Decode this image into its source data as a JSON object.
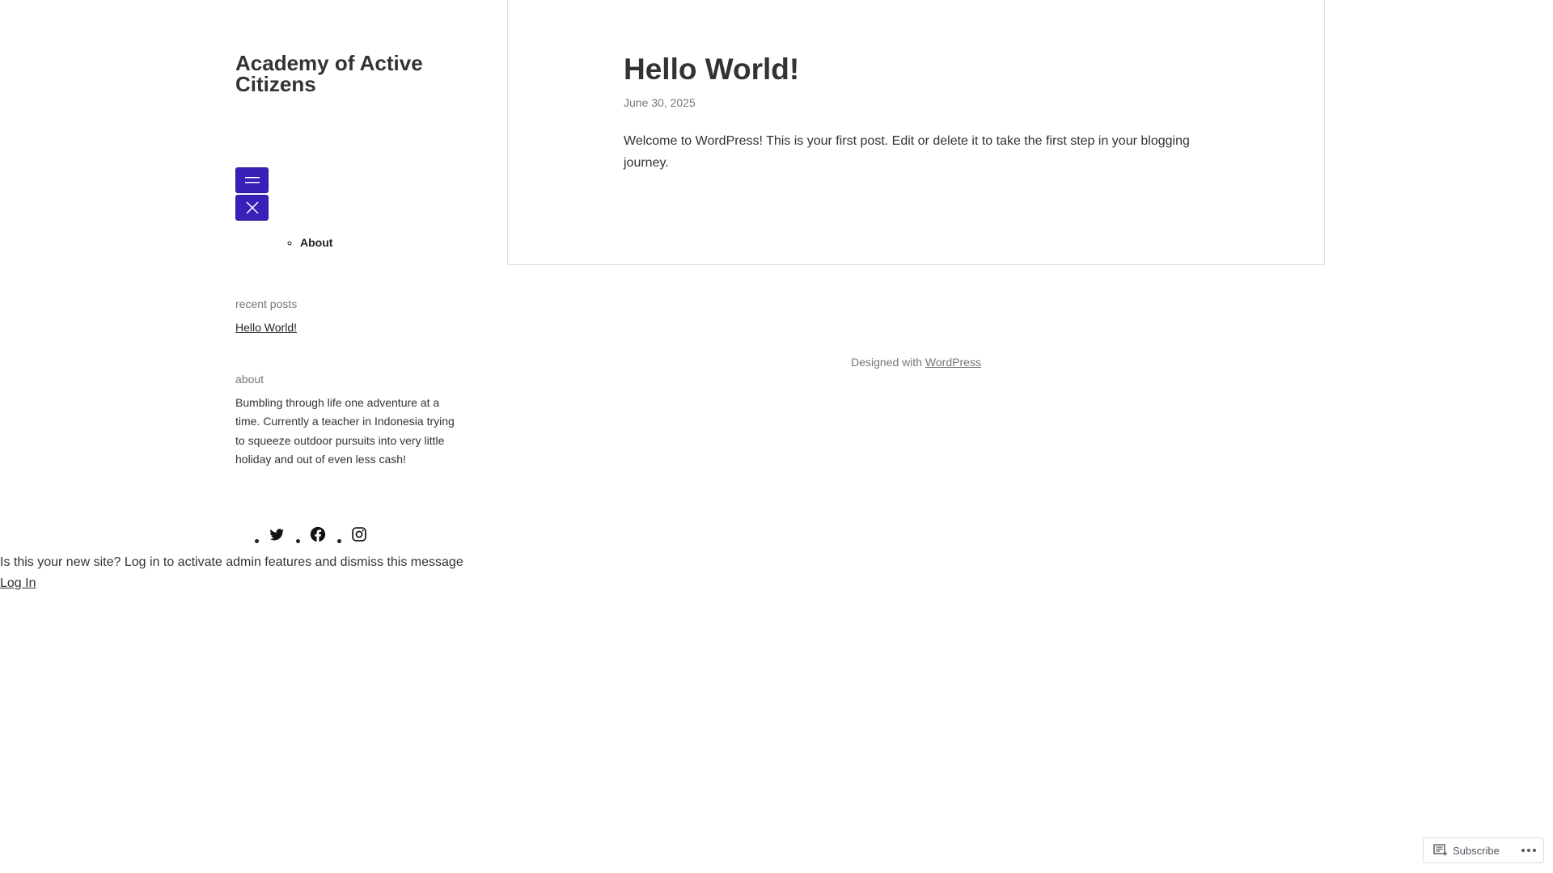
{
  "site": {
    "title": "Academy of Active Citizens"
  },
  "menu": {
    "open_icon": "hamburger-icon",
    "close_icon": "close-icon",
    "items": [
      {
        "label": "About"
      }
    ]
  },
  "widgets": {
    "recent_posts": {
      "title": "recent posts",
      "items": [
        {
          "label": "Hello World!"
        }
      ]
    },
    "about": {
      "title": "about",
      "text": "Bumbling through life one adventure at a time. Currently a teacher in Indonesia trying to squeeze outdoor pursuits into very little holiday and out of even less cash!"
    },
    "social": [
      {
        "icon": "twitter-icon"
      },
      {
        "icon": "facebook-icon"
      },
      {
        "icon": "instagram-icon"
      }
    ]
  },
  "post": {
    "title": "Hello World!",
    "date": "June 30, 2025",
    "body": "Welcome to WordPress! This is your first post. Edit or delete it to take the first step in your blogging journey."
  },
  "footer": {
    "credit_prefix": "Designed with",
    "credit_link": "WordPress"
  },
  "admin_notice": {
    "message": "Is this your new site? Log in to activate admin features and dismiss this message",
    "login_label": "Log In"
  },
  "subscribe_bar": {
    "subscribe_label": "Subscribe",
    "subscribe_icon": "reader-icon",
    "more_icon": "ellipsis-icon"
  },
  "colors": {
    "menu_button": "#3a1fb8",
    "text": "#333333",
    "muted": "#767676"
  }
}
